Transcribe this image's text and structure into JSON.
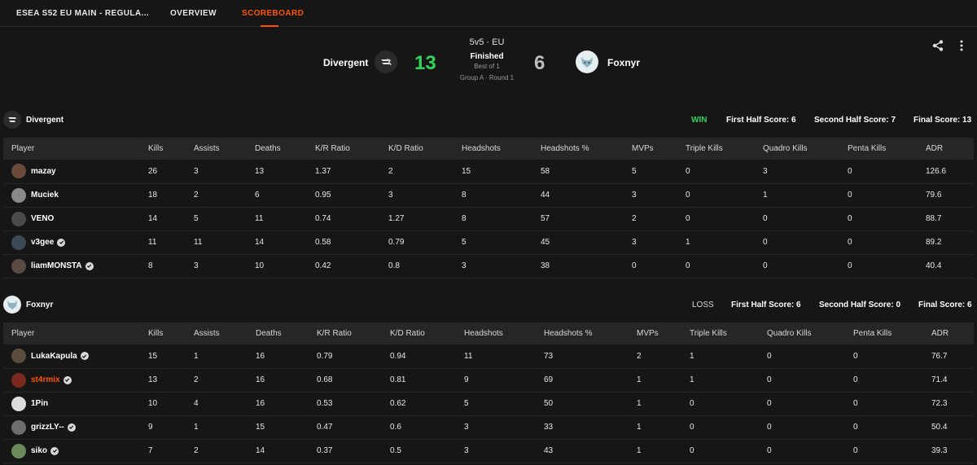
{
  "nav": {
    "tabs": [
      {
        "label": "ESEA S52 EU MAIN - REGULA...",
        "active": false
      },
      {
        "label": "OVERVIEW",
        "active": false
      },
      {
        "label": "SCOREBOARD",
        "active": true
      }
    ],
    "accent": "#ff5500"
  },
  "match": {
    "format": "5v5 · EU",
    "status": "Finished",
    "best_of": "Best of 1",
    "group": "Group A · Round 1",
    "team1": {
      "name": "Divergent",
      "score": "13"
    },
    "team2": {
      "name": "Foxnyr",
      "score": "6"
    },
    "win_color": "#32d35a",
    "icons": [
      "share-icon",
      "more-vert-icon"
    ]
  },
  "columns": [
    "Player",
    "Kills",
    "Assists",
    "Deaths",
    "K/R Ratio",
    "K/D Ratio",
    "Headshots",
    "Headshots %",
    "MVPs",
    "Triple Kills",
    "Quadro Kills",
    "Penta Kills",
    "ADR"
  ],
  "teams": [
    {
      "name": "Divergent",
      "result": "WIN",
      "first_half": "First Half Score: 6",
      "second_half": "Second Half Score: 7",
      "final": "Final Score: 13",
      "players": [
        {
          "name": "mazay",
          "verified": false,
          "highlight": false,
          "stats": [
            "26",
            "3",
            "13",
            "1.37",
            "2",
            "15",
            "58",
            "5",
            "0",
            "3",
            "0",
            "126.6"
          ]
        },
        {
          "name": "Muciek",
          "verified": false,
          "highlight": false,
          "stats": [
            "18",
            "2",
            "6",
            "0.95",
            "3",
            "8",
            "44",
            "3",
            "0",
            "1",
            "0",
            "79.6"
          ]
        },
        {
          "name": "VENO",
          "verified": false,
          "highlight": false,
          "stats": [
            "14",
            "5",
            "11",
            "0.74",
            "1.27",
            "8",
            "57",
            "2",
            "0",
            "0",
            "0",
            "88.7"
          ]
        },
        {
          "name": "v3gee",
          "verified": true,
          "highlight": false,
          "stats": [
            "11",
            "11",
            "14",
            "0.58",
            "0.79",
            "5",
            "45",
            "3",
            "1",
            "0",
            "0",
            "89.2"
          ]
        },
        {
          "name": "liamMONSTA",
          "verified": true,
          "highlight": false,
          "stats": [
            "8",
            "3",
            "10",
            "0.42",
            "0.8",
            "3",
            "38",
            "0",
            "0",
            "0",
            "0",
            "40.4"
          ]
        }
      ]
    },
    {
      "name": "Foxnyr",
      "result": "LOSS",
      "first_half": "First Half Score: 6",
      "second_half": "Second Half Score: 0",
      "final": "Final Score: 6",
      "players": [
        {
          "name": "LukaKapula",
          "verified": true,
          "highlight": false,
          "stats": [
            "15",
            "1",
            "16",
            "0.79",
            "0.94",
            "11",
            "73",
            "2",
            "1",
            "0",
            "0",
            "76.7"
          ]
        },
        {
          "name": "st4rmix",
          "verified": true,
          "highlight": true,
          "stats": [
            "13",
            "2",
            "16",
            "0.68",
            "0.81",
            "9",
            "69",
            "1",
            "1",
            "0",
            "0",
            "71.4"
          ]
        },
        {
          "name": "1Pin",
          "verified": false,
          "highlight": false,
          "stats": [
            "10",
            "4",
            "16",
            "0.53",
            "0.62",
            "5",
            "50",
            "1",
            "0",
            "0",
            "0",
            "72.3"
          ]
        },
        {
          "name": "grizzLY--",
          "verified": true,
          "highlight": false,
          "stats": [
            "9",
            "1",
            "15",
            "0.47",
            "0.6",
            "3",
            "33",
            "1",
            "0",
            "0",
            "0",
            "50.4"
          ]
        },
        {
          "name": "siko",
          "verified": true,
          "highlight": false,
          "stats": [
            "7",
            "2",
            "14",
            "0.37",
            "0.5",
            "3",
            "43",
            "1",
            "0",
            "0",
            "0",
            "39.3"
          ]
        }
      ]
    }
  ]
}
